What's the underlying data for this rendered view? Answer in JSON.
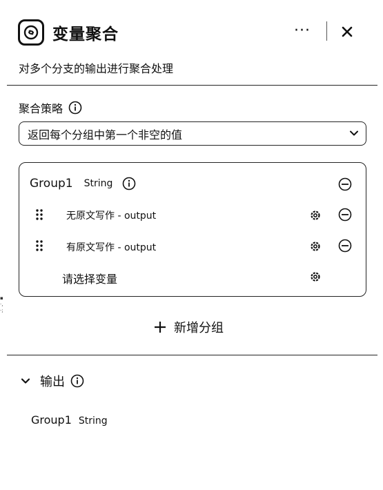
{
  "header": {
    "title": "变量聚合",
    "more_label": "···",
    "icons": {
      "node": "aggregate-node-icon",
      "close": "close-icon"
    }
  },
  "description": "对多个分支的输出进行聚合处理",
  "strategy": {
    "label": "聚合策略",
    "selected": "返回每个分组中第一个非空的值"
  },
  "group": {
    "name": "Group1",
    "type": "String",
    "variables": [
      {
        "label": "无原文写作 - output"
      },
      {
        "label": "有原文写作 - output"
      }
    ],
    "placeholder": "请选择变量"
  },
  "add_group_label": "新增分组",
  "output": {
    "title": "输出",
    "items": [
      {
        "name": "Group1",
        "type": "String"
      }
    ]
  },
  "colors": {
    "text": "#111111",
    "border": "#222222",
    "background": "#ffffff"
  }
}
